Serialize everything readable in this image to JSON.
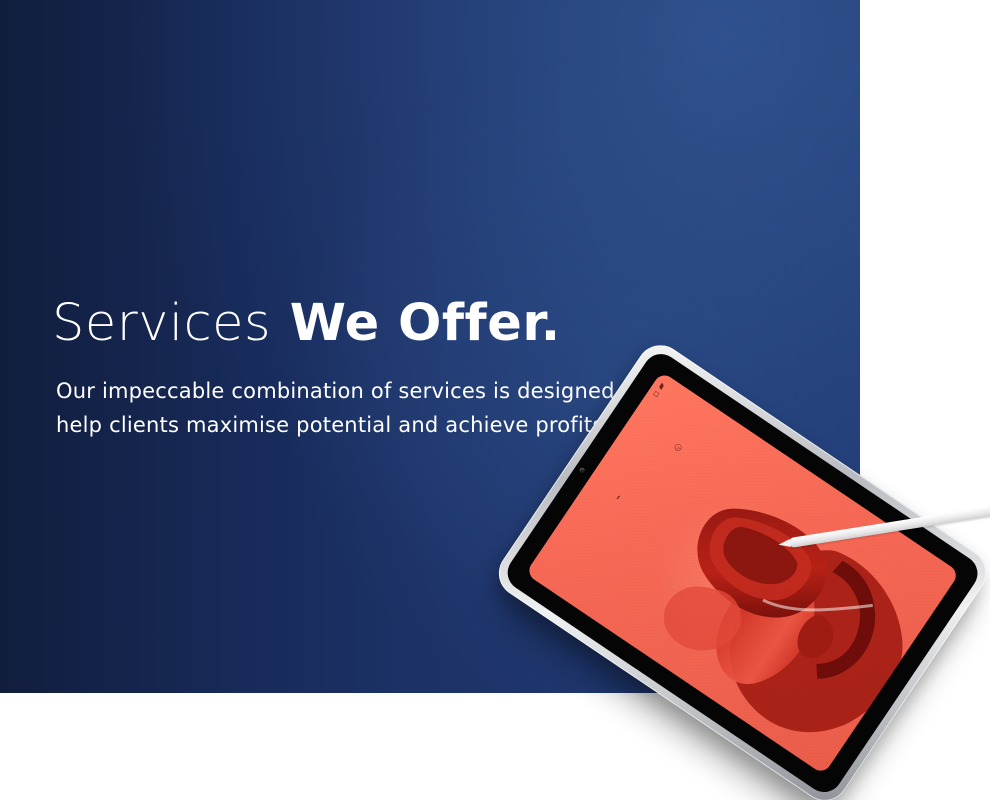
{
  "hero": {
    "title_light": "Services",
    "title_bold": "We Offer.",
    "description": "Our impeccable combination of services is designed to help clients maximise potential and achieve profits.",
    "background_colors": {
      "dark": "#111d3d",
      "mid": "#1d3368",
      "highlight": "#365b9a"
    }
  },
  "tablet_mockup": {
    "screen_color": "#f56854",
    "icon": "tablet-icon"
  }
}
